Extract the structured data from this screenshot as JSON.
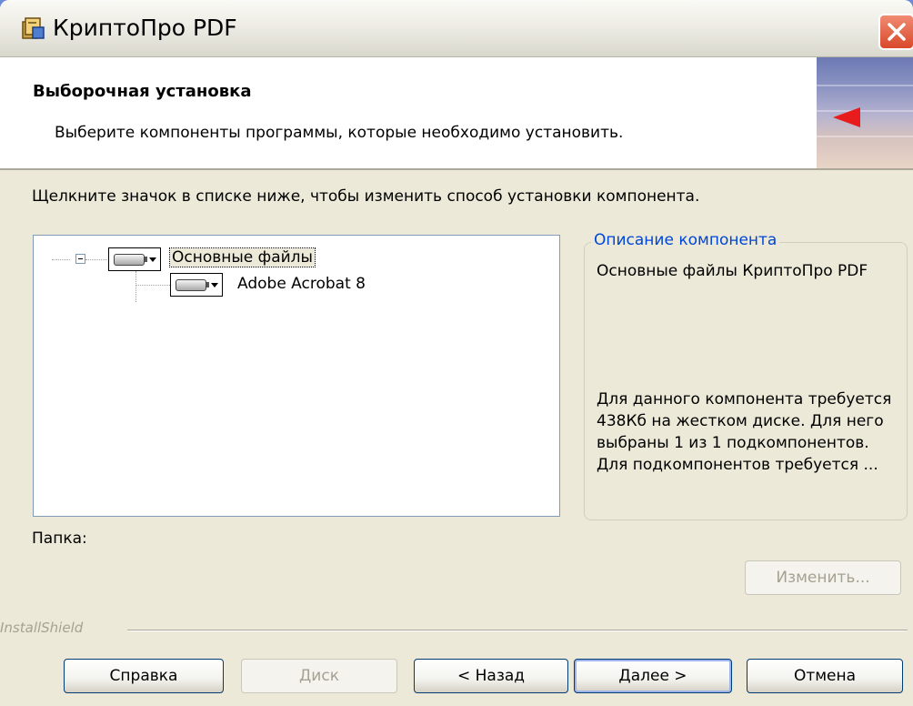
{
  "window": {
    "title": "КриптоПро PDF"
  },
  "banner": {
    "title": "Выборочная установка",
    "subtitle": "Выберите компоненты программы, которые необходимо установить."
  },
  "instruction": "Щелкните значок в списке ниже, чтобы изменить способ установки компонента.",
  "tree": {
    "items": [
      {
        "label": "Основные файлы"
      },
      {
        "label": "Adobe Acrobat 8"
      }
    ]
  },
  "description": {
    "group_title": "Описание компонента",
    "text": "Основные файлы КриптоПро PDF",
    "details": "Для данного компонента требуется 438Кб на жестком диске. Для него выбраны 1 из 1 подкомпонентов. Для подкомпонентов требуется ..."
  },
  "folder": {
    "label": "Папка:"
  },
  "buttons": {
    "change": "Изменить...",
    "help": "Справка",
    "disk": "Диск",
    "back": "< Назад",
    "next": "Далее >",
    "cancel": "Отмена"
  },
  "footer": {
    "brand": "InstallShield"
  },
  "colors": {
    "window_bg": "#ece9d8",
    "group_title": "#0046d5",
    "close_button": "#d9492a",
    "arrow": "#e81c1c"
  },
  "icons": {
    "app": "installer-icon",
    "close": "close-icon",
    "banner": "red-arrow-icon",
    "feature_state": "hard-drive-icon"
  }
}
